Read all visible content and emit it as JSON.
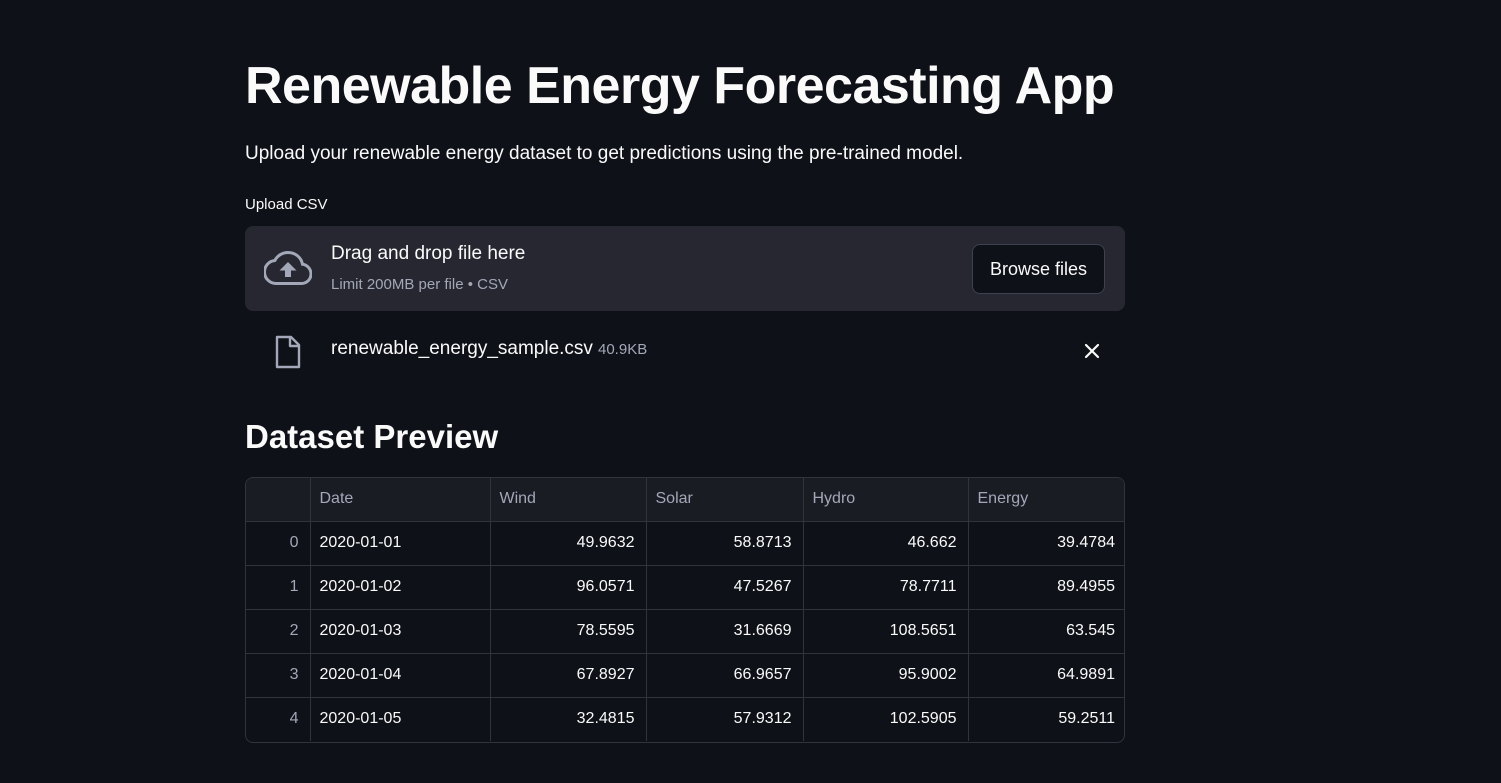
{
  "page": {
    "title": "Renewable Energy Forecasting App",
    "subtitle": "Upload your renewable energy dataset to get predictions using the pre-trained model."
  },
  "uploader": {
    "label": "Upload CSV",
    "drop_text": "Drag and drop file here",
    "limit_text": "Limit 200MB per file • CSV",
    "browse_label": "Browse files",
    "icon": "cloud-upload-icon"
  },
  "uploaded_file": {
    "name": "renewable_energy_sample.csv",
    "size": "40.9KB",
    "icon": "file-icon"
  },
  "preview": {
    "title": "Dataset Preview",
    "columns": [
      "",
      "Date",
      "Wind",
      "Solar",
      "Hydro",
      "Energy"
    ],
    "rows": [
      [
        "0",
        "2020-01-01",
        "49.9632",
        "58.8713",
        "46.662",
        "39.4784"
      ],
      [
        "1",
        "2020-01-02",
        "96.0571",
        "47.5267",
        "78.7711",
        "89.4955"
      ],
      [
        "2",
        "2020-01-03",
        "78.5595",
        "31.6669",
        "108.5651",
        "63.545"
      ],
      [
        "3",
        "2020-01-04",
        "67.8927",
        "66.9657",
        "95.9002",
        "64.9891"
      ],
      [
        "4",
        "2020-01-05",
        "32.4815",
        "57.9312",
        "102.5905",
        "59.2511"
      ]
    ]
  },
  "colors": {
    "background": "#0e1117",
    "panel": "#262730",
    "text": "#fafafa",
    "muted": "#a3a8b8"
  }
}
